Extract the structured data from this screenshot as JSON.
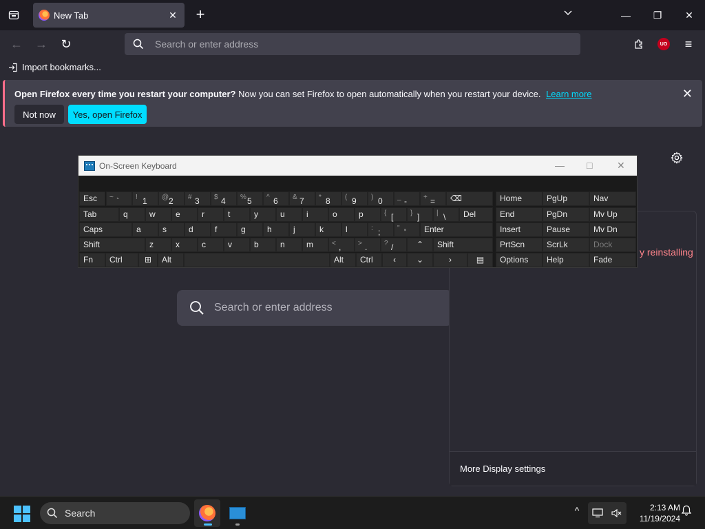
{
  "tabstrip": {
    "active_tab_title": "New Tab",
    "new_tab_glyph": "+",
    "overflow_glyph": "⌄",
    "close_glyph": "✕",
    "window_controls": {
      "minimize": "—",
      "restore": "❐",
      "close": "✕"
    }
  },
  "navbar": {
    "back_glyph": "←",
    "forward_glyph": "→",
    "reload_glyph": "↻",
    "url_placeholder": "Search or enter address",
    "ublock_label": "UO",
    "menu_glyph": "≡"
  },
  "bookmarks": {
    "import_label": "Import bookmarks..."
  },
  "notification": {
    "title": "Open Firefox every time you restart your computer?",
    "message": "Now you can set Firefox to open automatically when you restart your device.",
    "link": "Learn more",
    "not_now": "Not now",
    "yes_open": "Yes, open Firefox",
    "accent": "#ff6e8b"
  },
  "content": {
    "search_placeholder": "Search or enter address",
    "display_hint": "y reinstalling",
    "display_footer": "More Display settings"
  },
  "osk": {
    "title": "On-Screen Keyboard",
    "controls": {
      "minimize": "—",
      "maximize": "□",
      "close": "✕"
    },
    "row1": [
      {
        "sh": "~",
        "mn": "`"
      },
      {
        "sh": "!",
        "mn": "1"
      },
      {
        "sh": "@",
        "mn": "2"
      },
      {
        "sh": "#",
        "mn": "3"
      },
      {
        "sh": "$",
        "mn": "4"
      },
      {
        "sh": "%",
        "mn": "5"
      },
      {
        "sh": "^",
        "mn": "6"
      },
      {
        "sh": "&",
        "mn": "7"
      },
      {
        "sh": "*",
        "mn": "8"
      },
      {
        "sh": "(",
        "mn": "9"
      },
      {
        "sh": ")",
        "mn": "0"
      },
      {
        "sh": "_",
        "mn": "-"
      },
      {
        "sh": "+",
        "mn": "="
      }
    ],
    "row2_letters": [
      "q",
      "w",
      "e",
      "r",
      "t",
      "y",
      "u",
      "i",
      "o",
      "p"
    ],
    "row2_brackets": [
      {
        "sh": "{",
        "mn": "["
      },
      {
        "sh": "}",
        "mn": "]"
      },
      {
        "sh": "|",
        "mn": "\\"
      }
    ],
    "row3_letters": [
      "a",
      "s",
      "d",
      "f",
      "g",
      "h",
      "j",
      "k",
      "l"
    ],
    "row3_punct": [
      {
        "sh": ":",
        "mn": ";"
      },
      {
        "sh": "\"",
        "mn": "'"
      }
    ],
    "row4_letters": [
      "z",
      "x",
      "c",
      "v",
      "b",
      "n",
      "m"
    ],
    "row4_punct": [
      {
        "sh": "<",
        "mn": ","
      },
      {
        "sh": ">",
        "mn": "."
      },
      {
        "sh": "?",
        "mn": "/"
      }
    ],
    "labels": {
      "esc": "Esc",
      "backspace": "⌫",
      "tab": "Tab",
      "del": "Del",
      "caps": "Caps",
      "enter": "Enter",
      "shift": "Shift",
      "fn": "Fn",
      "ctrl": "Ctrl",
      "win": "⊞",
      "alt": "Alt",
      "up": "⌃",
      "down": "⌄",
      "left": "‹",
      "right": "›",
      "menu": "▤"
    },
    "nav_keys": [
      [
        "Home",
        "PgUp",
        "Nav"
      ],
      [
        "End",
        "PgDn",
        "Mv Up"
      ],
      [
        "Insert",
        "Pause",
        "Mv Dn"
      ],
      [
        "PrtScn",
        "ScrLk",
        "Dock"
      ],
      [
        "Options",
        "Help",
        "Fade"
      ]
    ]
  },
  "taskbar": {
    "search_label": "Search",
    "tray_chevron": "^",
    "time": "2:13 AM",
    "date": "11/19/2024",
    "bell_glyph": "🔔"
  }
}
